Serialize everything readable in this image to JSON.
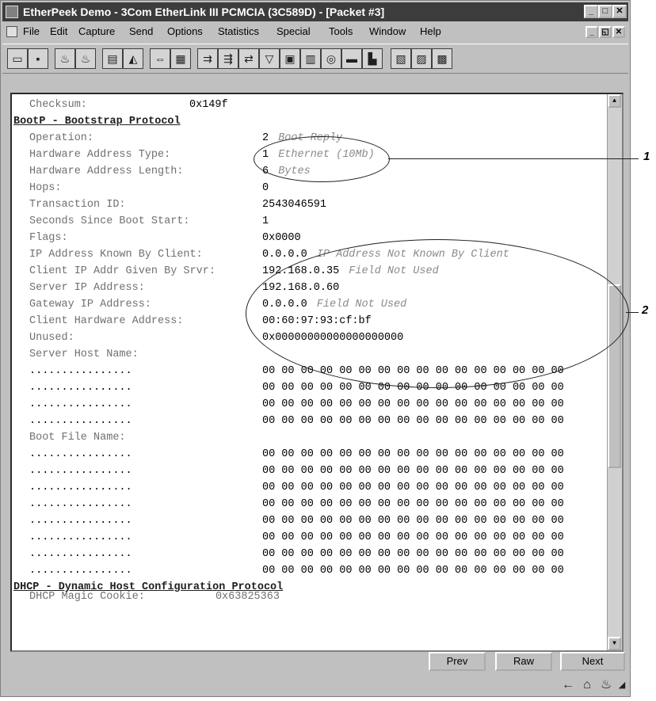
{
  "window": {
    "title": "EtherPeek Demo - 3Com EtherLink III PCMCIA (3C589D) - [Packet #3]"
  },
  "menu": [
    "File",
    "Edit",
    "Capture",
    "Send",
    "Options",
    "Statistics",
    "Special",
    "Tools",
    "Window",
    "Help"
  ],
  "toolbar_icons": [
    "open-icon",
    "save-icon",
    "capture-start-icon",
    "capture-stop-icon",
    "view-icon",
    "filter-icon",
    "trigger-icon",
    "packet-list-icon",
    "send-icon",
    "send-multi-icon",
    "send-edit-icon",
    "filter-funnel-icon",
    "node-stats-icon",
    "protocol-stats-icon",
    "dashboard-icon",
    "history-icon",
    "graph-icon",
    "print-icon",
    "export-icon",
    "properties-icon"
  ],
  "decode": {
    "checksum": {
      "label": "Checksum:",
      "value": "0x149f"
    },
    "bootp_header": "BootP - Bootstrap Protocol",
    "fields": [
      {
        "label": "Operation:",
        "value": "2",
        "note": "Boot Reply"
      },
      {
        "label": "Hardware Address Type:",
        "value": "1",
        "note": "Ethernet (10Mb)"
      },
      {
        "label": "Hardware Address Length:",
        "value": "6",
        "note": "Bytes"
      },
      {
        "label": "Hops:",
        "value": "0",
        "note": ""
      },
      {
        "label": "Transaction ID:",
        "value": "2543046591",
        "note": ""
      },
      {
        "label": "Seconds Since Boot Start:",
        "value": "1",
        "note": ""
      },
      {
        "label": "Flags:",
        "value": "0x0000",
        "note": ""
      },
      {
        "label": "IP Address Known By Client:",
        "value": "0.0.0.0",
        "note": "IP Address Not Known By Client"
      },
      {
        "label": "Client IP Addr Given By Srvr:",
        "value": "192.168.0.35",
        "note": "Field Not Used"
      },
      {
        "label": "Server IP Address:",
        "value": "192.168.0.60",
        "note": ""
      },
      {
        "label": "Gateway IP Address:",
        "value": "0.0.0.0",
        "note": "Field Not Used"
      },
      {
        "label": "Client Hardware Address:",
        "value": "00:60:97:93:cf:bf",
        "note": ""
      },
      {
        "label": "Unused:",
        "value": "0x00000000000000000000",
        "note": ""
      },
      {
        "label": "Server Host Name:",
        "value": "",
        "note": ""
      }
    ],
    "dots": "................",
    "hex_row": "00 00 00 00 00 00 00 00 00 00 00 00 00 00 00 00",
    "server_host_rows": 4,
    "boot_file_label": "Boot File Name:",
    "boot_file_rows": 8,
    "dhcp_header": "DHCP - Dynamic Host Configuration Protocol",
    "partial_line": "DHCP Magic Cookie:           0x63825363"
  },
  "buttons": {
    "prev": "Prev",
    "raw": "Raw",
    "next": "Next"
  },
  "callouts": [
    "1",
    "2"
  ]
}
